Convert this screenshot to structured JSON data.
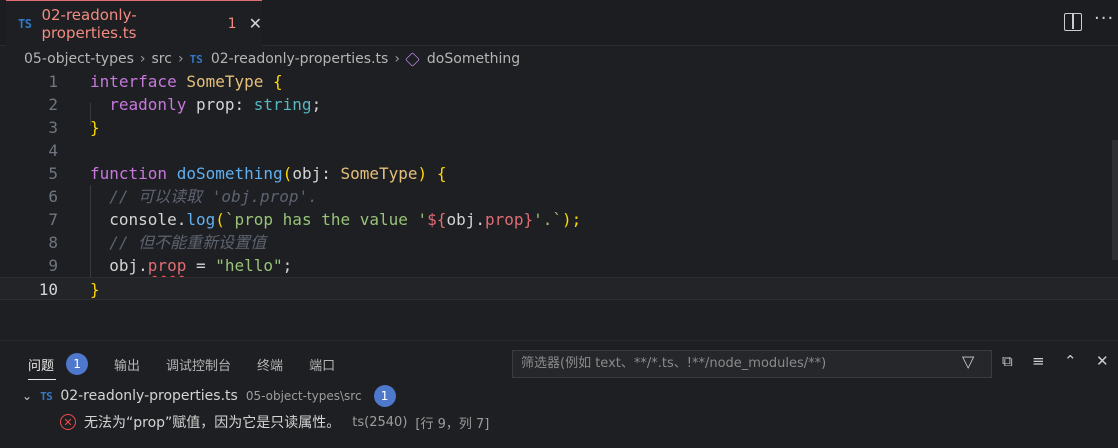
{
  "tab": {
    "badge": "TS",
    "title": "02-readonly-properties.ts",
    "count": "1",
    "close": "✕"
  },
  "breadcrumb": {
    "seg1": "05-object-types",
    "seg2": "src",
    "ts": "TS",
    "seg3": "02-readonly-properties.ts",
    "seg4": "doSomething"
  },
  "editor": {
    "line_numbers": [
      "1",
      "2",
      "3",
      "4",
      "5",
      "6",
      "7",
      "8",
      "9",
      "10"
    ],
    "lines": {
      "l1a": "interface",
      "l1b": " ",
      "l1c": "SomeType",
      "l1d": " {",
      "l2a": "  ",
      "l2b": "readonly",
      "l2c": " prop: ",
      "l2d": "string",
      "l2e": ";",
      "l3": "}",
      "l5a": "function",
      "l5b": " ",
      "l5c": "doSomething",
      "l5d": "(",
      "l5e": "obj",
      "l5f": ": ",
      "l5g": "SomeType",
      "l5h": ")",
      "l5i": " {",
      "l6": "  // 可以读取 'obj.prop'.",
      "l7a": "  console.",
      "l7b": "log",
      "l7c": "(",
      "l7d": "`prop has the value '",
      "l7e": "${",
      "l7f": "obj.",
      "l7g": "prop",
      "l7h": "}",
      "l7i": "'.`",
      "l7j": ");",
      "l8": "  // 但不能重新设置值",
      "l9a": "  obj.",
      "l9b": "prop",
      "l9c": " = ",
      "l9d": "\"hello\"",
      "l9e": ";",
      "l10": "}"
    }
  },
  "panel": {
    "tabs": [
      "问题",
      "输出",
      "调试控制台",
      "终端",
      "端口"
    ],
    "problems_count": "1",
    "filter_placeholder": "筛选器(例如 text、**/*.ts、!**/node_modules/**)",
    "file": {
      "badge": "TS",
      "name": "02-readonly-properties.ts",
      "path": "05-object-types\\src",
      "count": "1"
    },
    "problem": {
      "message": "无法为“prop”赋值，因为它是只读属性。",
      "code": "ts(2540)",
      "location": "[行 9，列 7]"
    }
  },
  "colors": {
    "keyword": "#c678dd",
    "type": "#e5c07b",
    "function": "#61afef",
    "property": "#e06c75",
    "string": "#98c379",
    "comment": "#5c6370",
    "error": "#f14c4c",
    "badge": "#4d78cc"
  }
}
